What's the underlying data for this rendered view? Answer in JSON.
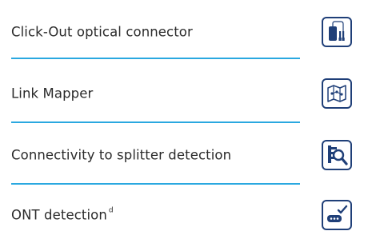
{
  "features": [
    {
      "label": "Click-Out optical connector",
      "icon": "click-out-connector-icon"
    },
    {
      "label": "Link Mapper",
      "icon": "map-icon"
    },
    {
      "label": "Connectivity to splitter detection",
      "icon": "splitter-detection-icon"
    },
    {
      "label": "ONT detection",
      "superscript": "d",
      "icon": "ont-device-icon"
    }
  ],
  "colors": {
    "icon_stroke": "#1f3f78",
    "divider": "#2aa8e0",
    "text": "#2b2b2b"
  }
}
